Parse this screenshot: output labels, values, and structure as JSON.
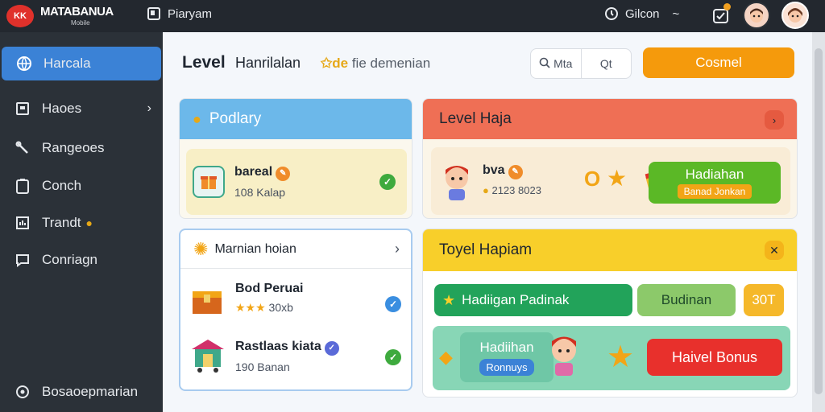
{
  "topbar": {
    "logo_text": "KK",
    "brand": "MATABANUA",
    "brand_sub": "Mobile",
    "nav_label": "Piaryam",
    "center_label": "Gilcon",
    "center_extra": "~"
  },
  "sidebar": {
    "items": [
      {
        "label": "Harcala",
        "icon": "globe-icon"
      },
      {
        "label": "Haoes",
        "icon": "home-icon"
      },
      {
        "label": "Rangeoes",
        "icon": "tools-icon"
      },
      {
        "label": "Conch",
        "icon": "clipboard-icon"
      },
      {
        "label": "Trandt",
        "icon": "chart-icon"
      },
      {
        "label": "Conriagn",
        "icon": "chat-icon"
      }
    ],
    "footer": "Bosaoepmarian"
  },
  "header": {
    "title": "Level",
    "subtitle": "Hanrilalan",
    "extra_star": "✩de",
    "extra_text": "fie demenian"
  },
  "search": {
    "left_label": "Mta",
    "right_label": "Qt"
  },
  "primary_button": "Cosmel",
  "podlary": {
    "title": "Podlary",
    "item": {
      "title": "bareal",
      "sub": "108 Kalap"
    }
  },
  "level_panel": {
    "title": "Level Haja",
    "item": {
      "title": "bva",
      "sub": "2123 8023"
    },
    "button_top": "Hadiahan",
    "button_bottom": "Banad Jonkan"
  },
  "list_card": {
    "title": "Marnian hoian",
    "items": [
      {
        "title": "Bod Peruai",
        "sub": "30xb",
        "stars": "★★★"
      },
      {
        "title": "Rastlaas kiata",
        "sub": "190 Banan"
      }
    ]
  },
  "toyel": {
    "title": "Toyel Hapiam",
    "green_pill": "Hadiigan Padinak",
    "light_pill": "Budinan",
    "orange_pill": "30T",
    "bonus_top": "Hadiihan",
    "bonus_bottom": "Ronnuys",
    "bonus_button": "Haivel Bonus"
  },
  "colors": {
    "accent_blue": "#3b82d6",
    "orange": "#f59a0c",
    "green": "#22a35a",
    "red": "#e8302c"
  }
}
